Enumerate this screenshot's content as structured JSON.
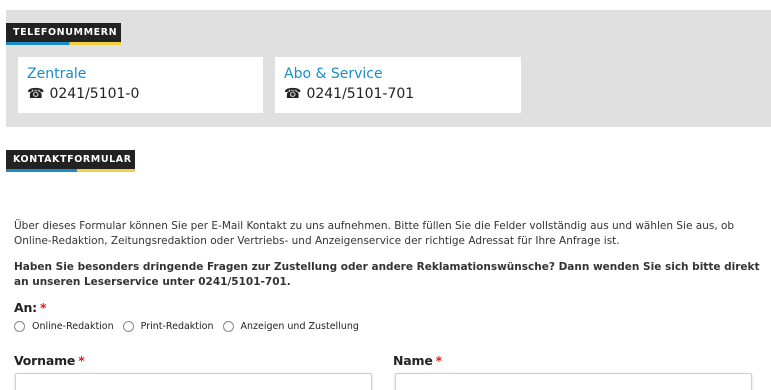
{
  "phone": {
    "heading": "TELEFONUMMERN",
    "cards": [
      {
        "title": "Zentrale",
        "number": "0241/5101-0",
        "icon": "phone-icon"
      },
      {
        "title": "Abo & Service",
        "number": "0241/5101-701",
        "icon": "phone-icon"
      }
    ]
  },
  "contact": {
    "heading": "KONTAKTFORMULAR",
    "intro": "Über dieses Formular können Sie per E-Mail Kontakt zu uns aufnehmen. Bitte füllen Sie die Felder vollständig aus und wählen Sie aus, ob Online-Redaktion, Zeitungsredaktion oder Vertriebs- und Anzeigenservice der richtige Adressat für Ihre Anfrage ist.",
    "urgent": "Haben Sie besonders dringende Fragen zur Zustellung oder andere Reklamationswünsche? Dann wenden Sie sich bitte direkt an unseren Leserservice unter 0241/5101-701.",
    "to_label": "An:",
    "required_mark": "*",
    "recipients": [
      "Online-Redaktion",
      "Print-Redaktion",
      "Anzeigen und Zustellung"
    ],
    "firstname_label": "Vorname",
    "lastname_label": "Name"
  },
  "colors": {
    "accent_blue": "#1a8dc5",
    "accent_yellow": "#f0d040",
    "required_red": "#d62020",
    "section_bg": "#e0e0e0"
  }
}
